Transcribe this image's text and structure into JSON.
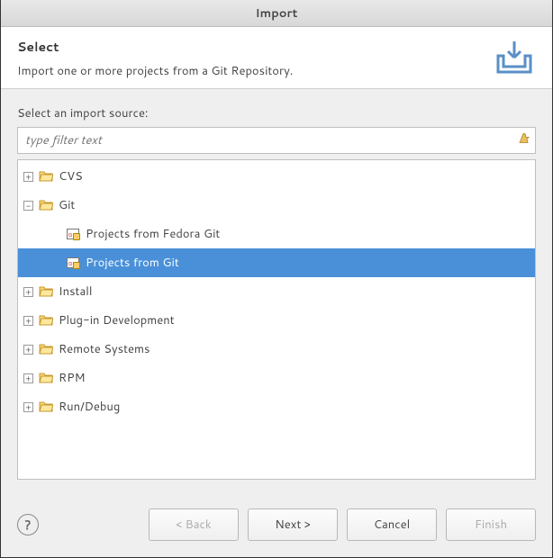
{
  "titlebar": "Import",
  "header": {
    "title": "Select",
    "subtitle": "Import one or more projects from a Git Repository."
  },
  "body": {
    "source_label": "Select an import source:",
    "filter_placeholder": "type filter text"
  },
  "tree": [
    {
      "label": "CVS",
      "expanded": false,
      "depth": 1,
      "icon": "folder",
      "hasChildren": true,
      "selected": false
    },
    {
      "label": "Git",
      "expanded": true,
      "depth": 1,
      "icon": "folder",
      "hasChildren": true,
      "selected": false
    },
    {
      "label": "Projects from Fedora Git",
      "expanded": false,
      "depth": 2,
      "icon": "git",
      "hasChildren": false,
      "selected": false
    },
    {
      "label": "Projects from Git",
      "expanded": false,
      "depth": 2,
      "icon": "git",
      "hasChildren": false,
      "selected": true
    },
    {
      "label": "Install",
      "expanded": false,
      "depth": 1,
      "icon": "folder",
      "hasChildren": true,
      "selected": false
    },
    {
      "label": "Plug-in Development",
      "expanded": false,
      "depth": 1,
      "icon": "folder",
      "hasChildren": true,
      "selected": false
    },
    {
      "label": "Remote Systems",
      "expanded": false,
      "depth": 1,
      "icon": "folder",
      "hasChildren": true,
      "selected": false
    },
    {
      "label": "RPM",
      "expanded": false,
      "depth": 1,
      "icon": "folder",
      "hasChildren": true,
      "selected": false
    },
    {
      "label": "Run/Debug",
      "expanded": false,
      "depth": 1,
      "icon": "folder",
      "hasChildren": true,
      "selected": false
    }
  ],
  "buttons": {
    "back": "< Back",
    "next": "Next >",
    "cancel": "Cancel",
    "finish": "Finish"
  },
  "buttons_enabled": {
    "back": false,
    "next": true,
    "cancel": true,
    "finish": false
  }
}
